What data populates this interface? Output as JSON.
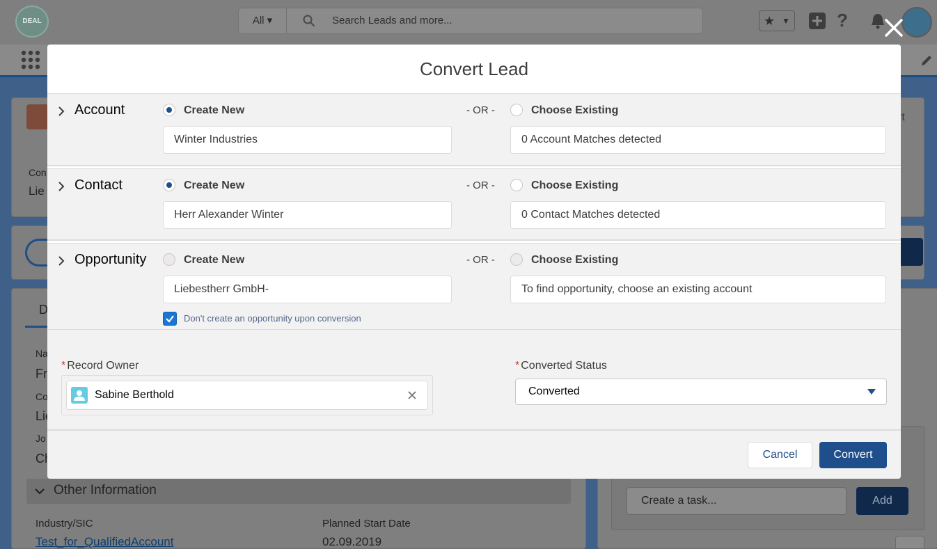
{
  "background": {
    "logo_text": "DEAL",
    "search_scope": "All",
    "search_placeholder": "Search Leads and more...",
    "card_details_tab": "D",
    "field_labels": [
      "Na",
      "Co",
      "Jo"
    ],
    "field_values": [
      "Fra",
      "Lie",
      "Ch"
    ],
    "header_field_label": "Con",
    "header_field_value": "Lie",
    "header_button": "rt",
    "other_information": "Other Information",
    "industry_label": "Industry/SIC",
    "industry_value": "Test_for_QualifiedAccount",
    "planned_start_label": "Planned Start Date",
    "planned_start_value": "02.09.2019",
    "task_placeholder": "Create a task...",
    "add_button": "Add"
  },
  "modal": {
    "title": "Convert Lead",
    "or_text": "- OR -",
    "sections": {
      "account": {
        "title": "Account",
        "create_new_label": "Create New",
        "choose_existing_label": "Choose Existing",
        "new_value": "Winter Industries",
        "existing_value": "0 Account Matches detected"
      },
      "contact": {
        "title": "Contact",
        "create_new_label": "Create New",
        "choose_existing_label": "Choose Existing",
        "new_value": "Herr Alexander Winter",
        "existing_value": "0 Contact Matches detected"
      },
      "opportunity": {
        "title": "Opportunity",
        "create_new_label": "Create New",
        "choose_existing_label": "Choose Existing",
        "new_value": "Liebestherr GmbH-",
        "existing_value": "To find opportunity, choose an existing account",
        "dont_create_label": "Don't create an opportunity upon conversion",
        "dont_create_checked": true
      }
    },
    "record_owner": {
      "label": "Record Owner",
      "value": "Sabine Berthold"
    },
    "converted_status": {
      "label": "Converted Status",
      "value": "Converted"
    },
    "buttons": {
      "cancel": "Cancel",
      "convert": "Convert"
    }
  },
  "colors": {
    "brand": "#1f4e8c",
    "checkbox": "#1b76d3",
    "required": "#c23934"
  }
}
